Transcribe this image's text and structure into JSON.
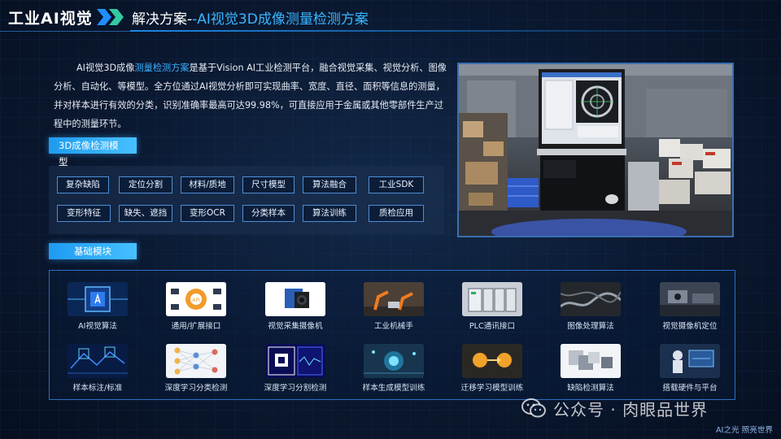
{
  "header": {
    "brand": "工业AI视觉",
    "title_prefix": "解决方案-",
    "title_accent": "-AI视觉3D成像测量检测方案"
  },
  "intro": {
    "part1": "AI视觉3D成像",
    "highlight": "测量检测方案",
    "part2": "是基于Vision AI工业检测平台，融合视觉采集、视觉分析、图像分析、自动化、等模型。全方位通过AI视觉分析即可实现曲率、宽度、直径、面积等信息的测量，并对样本进行有效的分类，识别准确率最高可达99.98%，可直接应用于金属或其他零部件生产过程中的测量环节。"
  },
  "model_section": {
    "title": "3D成像检测模型",
    "chips": [
      "复杂缺陷",
      "定位分割",
      "材料/质地",
      "尺寸模型",
      "算法融合",
      "工业SDK",
      "变形特征",
      "缺失、遮挡",
      "变形OCR",
      "分类样本",
      "算法训练",
      "质检应用"
    ]
  },
  "basic_section": {
    "title": "基础模块",
    "modules": [
      {
        "label": "AI视觉算法",
        "icon": "ai-chip-icon"
      },
      {
        "label": "通用/扩展接口",
        "icon": "api-gear-icon"
      },
      {
        "label": "视觉采集摄像机",
        "icon": "industrial-camera-icon"
      },
      {
        "label": "工业机械手",
        "icon": "robot-arm-icon"
      },
      {
        "label": "PLC通讯接口",
        "icon": "plc-controller-icon"
      },
      {
        "label": "图像处理算法",
        "icon": "image-processing-icon"
      },
      {
        "label": "视觉摄像机定位",
        "icon": "camera-positioning-icon"
      },
      {
        "label": "样本标注/标准",
        "icon": "sample-annotation-icon"
      },
      {
        "label": "深度学习分类检测",
        "icon": "neural-network-icon"
      },
      {
        "label": "深度学习分割检测",
        "icon": "segmentation-icon"
      },
      {
        "label": "样本生成模型训练",
        "icon": "model-training-icon"
      },
      {
        "label": "迁移学习模型训练",
        "icon": "transfer-learning-icon"
      },
      {
        "label": "缺陷检测算法",
        "icon": "defect-detection-icon"
      },
      {
        "label": "搭载硬件与平台",
        "icon": "hardware-platform-icon"
      }
    ]
  },
  "watermark": {
    "text": "公众号 · 肉眼品世界"
  },
  "footer": {
    "note": "AI之光  照亮世界"
  },
  "colors": {
    "accent": "#39b6ff",
    "tag": "#1e9bf0",
    "background": "#0a1830"
  }
}
